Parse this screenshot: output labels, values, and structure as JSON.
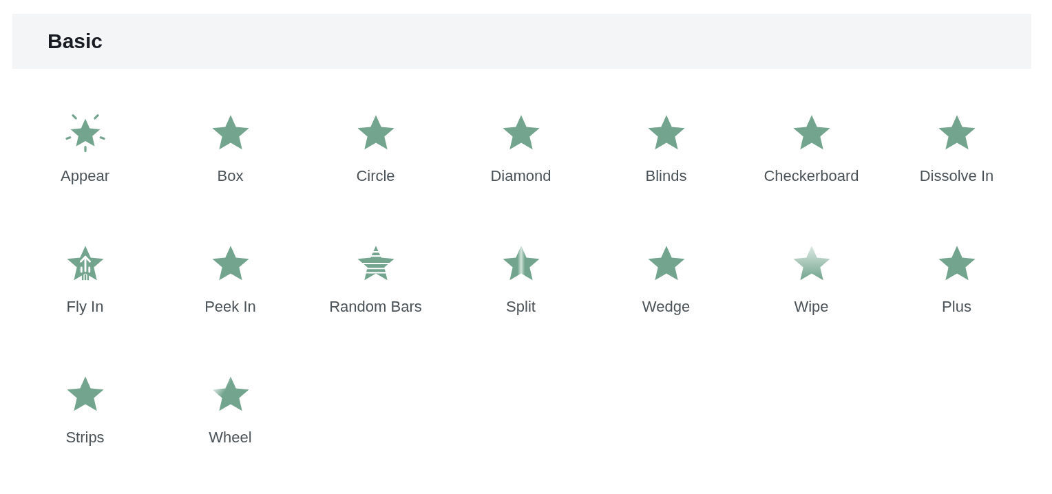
{
  "section": {
    "title": "Basic"
  },
  "effects": [
    {
      "label": "Appear",
      "kind": "burst"
    },
    {
      "label": "Box",
      "kind": "plain"
    },
    {
      "label": "Circle",
      "kind": "plain"
    },
    {
      "label": "Diamond",
      "kind": "plain"
    },
    {
      "label": "Blinds",
      "kind": "plain"
    },
    {
      "label": "Checkerboard",
      "kind": "plain"
    },
    {
      "label": "Dissolve In",
      "kind": "plain"
    },
    {
      "label": "Fly In",
      "kind": "arrow"
    },
    {
      "label": "Peek In",
      "kind": "plain"
    },
    {
      "label": "Random Bars",
      "kind": "striped"
    },
    {
      "label": "Split",
      "kind": "split"
    },
    {
      "label": "Wedge",
      "kind": "plain"
    },
    {
      "label": "Wipe",
      "kind": "fade"
    },
    {
      "label": "Plus",
      "kind": "plain"
    },
    {
      "label": "Strips",
      "kind": "plain"
    },
    {
      "label": "Wheel",
      "kind": "wheel"
    }
  ]
}
